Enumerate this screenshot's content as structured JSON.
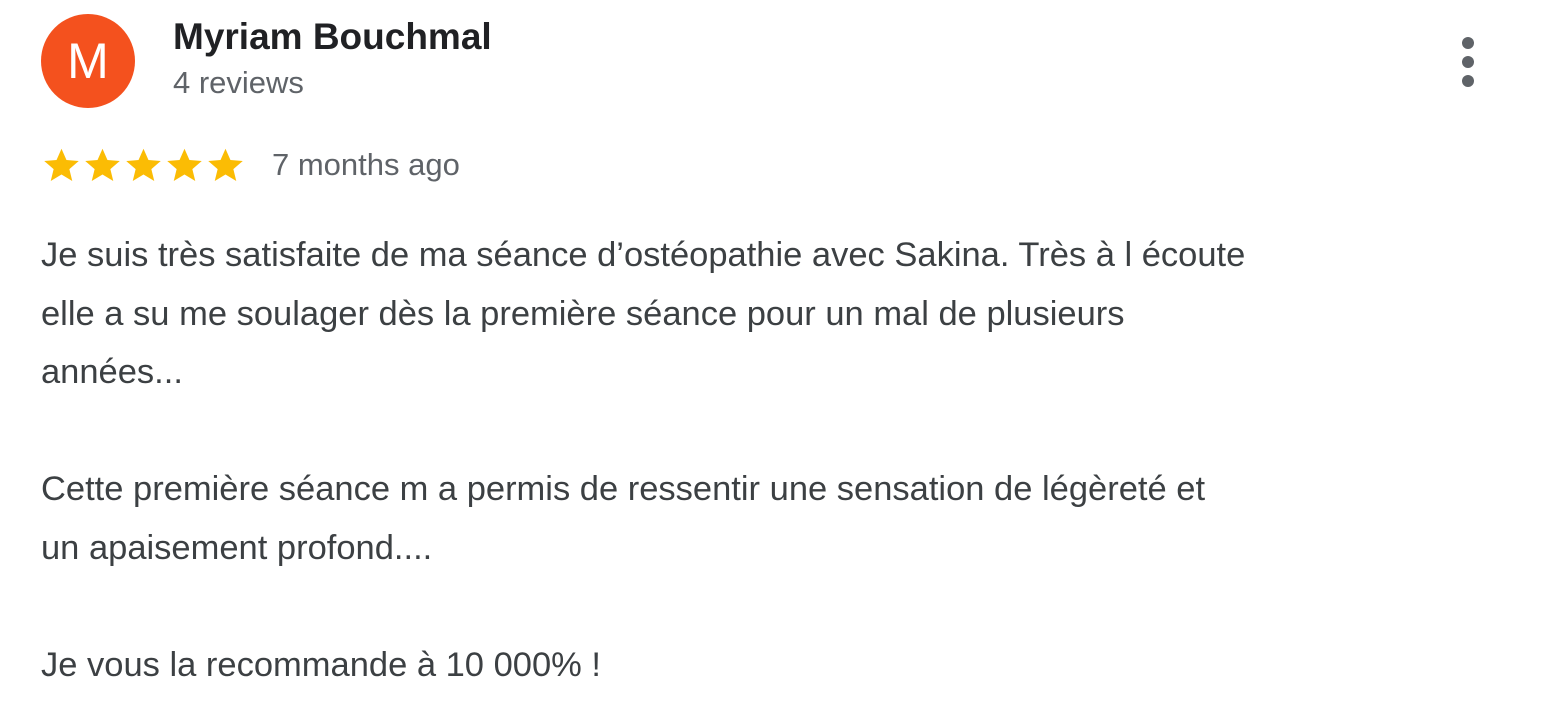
{
  "reviewer": {
    "avatar_letter": "M",
    "avatar_color": "#f4511e",
    "name": "Myriam Bouchmal",
    "review_count": "4 reviews"
  },
  "menu": {
    "icon": "more-vert-icon"
  },
  "review": {
    "rating": 5,
    "rating_max": 5,
    "star_color": "#fbbc04",
    "date": "7 months ago",
    "paragraphs": {
      "p1_line1": "Je suis très satisfaite de ma séance d’ostéopathie avec Sakina. Très à l écoute",
      "p1_line2": "elle a su me soulager dès la première séance pour un mal de plusieurs",
      "p1_line3": "années...",
      "p2_line1": "Cette première séance m a permis de ressentir une sensation de légèreté et",
      "p2_line2": "un apaisement profond....",
      "p3_line1": "Je vous la recommande à 10 000% !"
    }
  }
}
